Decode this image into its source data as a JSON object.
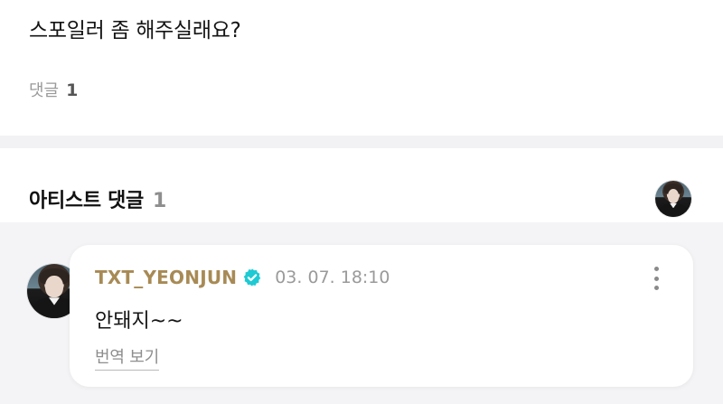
{
  "post": {
    "text": "스포일러 좀 해주실래요?",
    "comment_label": "댓글",
    "comment_count": "1"
  },
  "artist_comments": {
    "title": "아티스트 댓글",
    "count": "1"
  },
  "comment": {
    "author": "TXT_YEONJUN",
    "date": "03. 07. 18:10",
    "body": "안돼지~~",
    "translate_label": "번역 보기"
  },
  "colors": {
    "author": "#a88a55",
    "verified": "#1ecad3",
    "section_bg": "#f4f4f6"
  },
  "icons": {
    "verified": "verified-badge-icon",
    "more": "more-vertical-icon"
  }
}
